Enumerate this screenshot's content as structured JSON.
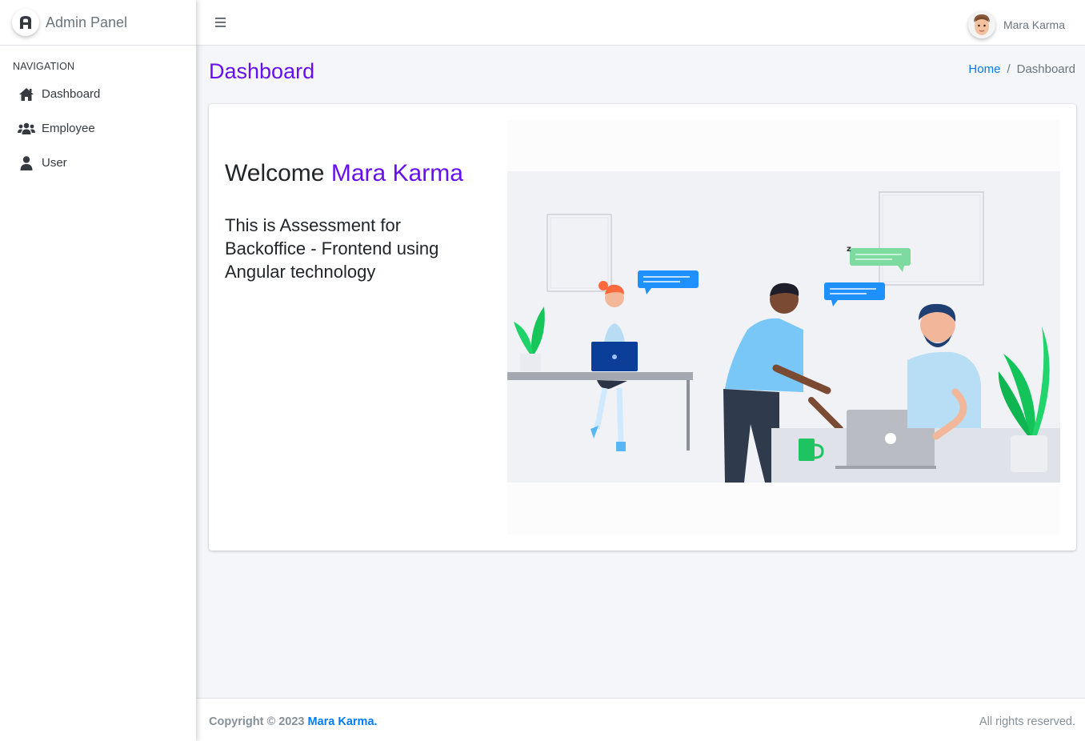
{
  "brand": {
    "logo_letter": "A",
    "title": "Admin Panel"
  },
  "sidebar": {
    "header": "NAVIGATION",
    "items": [
      {
        "label": "Dashboard",
        "icon": "home-icon"
      },
      {
        "label": "Employee",
        "icon": "users-icon"
      },
      {
        "label": "User",
        "icon": "user-icon"
      }
    ]
  },
  "navbar": {
    "user_name": "Mara Karma"
  },
  "content": {
    "title": "Dashboard",
    "breadcrumb": {
      "home": "Home",
      "separator": "/",
      "current": "Dashboard"
    }
  },
  "card": {
    "welcome_prefix": "Welcome ",
    "welcome_name": "Mara Karma",
    "description": "This is Assessment for Backoffice - Frontend using Angular technology"
  },
  "footer": {
    "copyright_prefix": "Copyright © 2023 ",
    "copyright_owner": "Mara Karma.",
    "rights": "All rights reserved."
  },
  "colors": {
    "accent": "#6610f2",
    "link": "#007bff",
    "text": "#212529",
    "muted": "#6c757d",
    "background": "#f4f6f9"
  }
}
